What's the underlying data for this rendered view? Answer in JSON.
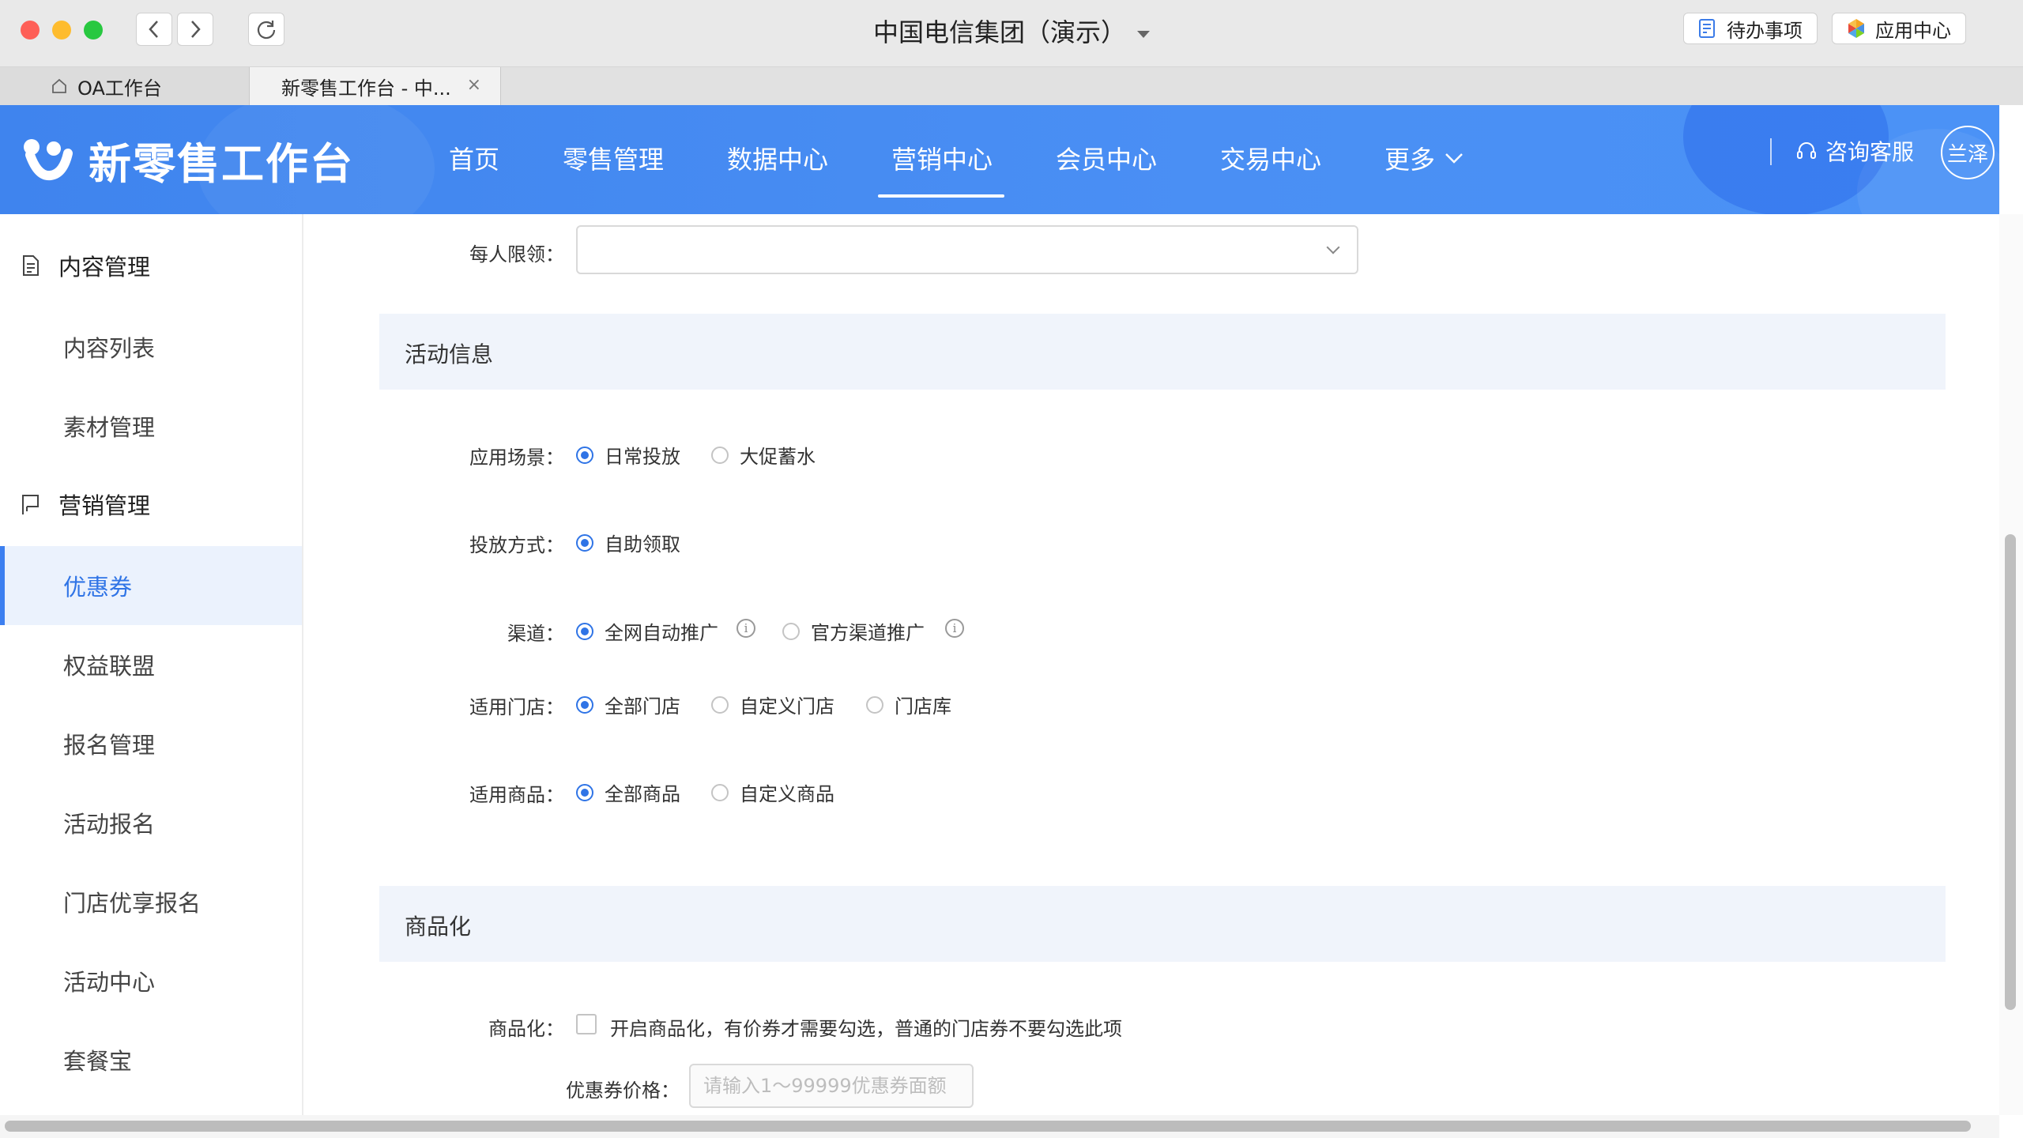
{
  "window": {
    "title": "中国电信集团（演示）",
    "todo_label": "待办事项",
    "apps_label": "应用中心"
  },
  "tabs": [
    {
      "label": "OA工作台"
    },
    {
      "label": "新零售工作台 - 中..."
    }
  ],
  "header": {
    "brand": "新零售工作台",
    "nav": [
      "首页",
      "零售管理",
      "数据中心",
      "营销中心",
      "会员中心",
      "交易中心",
      "更多"
    ],
    "active_nav": "营销中心",
    "support": "咨询客服",
    "user": "兰泽"
  },
  "sidebar": {
    "group1": "内容管理",
    "group1_items": [
      "内容列表",
      "素材管理"
    ],
    "group2": "营销管理",
    "group2_items": [
      "优惠券",
      "权益联盟",
      "报名管理",
      "活动报名",
      "门店优享报名",
      "活动中心",
      "套餐宝"
    ],
    "active_item": "优惠券"
  },
  "form": {
    "per_limit_label": "每人限领：",
    "section_activity": "活动信息",
    "scene_label": "应用场景：",
    "scene_options": [
      "日常投放",
      "大促蓄水"
    ],
    "method_label": "投放方式：",
    "method_options": [
      "自助领取"
    ],
    "channel_label": "渠道：",
    "channel_options": [
      "全网自动推广",
      "官方渠道推广"
    ],
    "store_label": "适用门店：",
    "store_options": [
      "全部门店",
      "自定义门店",
      "门店库"
    ],
    "goods_label": "适用商品：",
    "goods_options": [
      "全部商品",
      "自定义商品"
    ],
    "section_goods": "商品化",
    "commod_label": "商品化：",
    "commod_text": "开启商品化，有价券才需要勾选，普通的门店券不要勾选此项",
    "price_label": "优惠券价格：",
    "price_placeholder": "请输入1～99999优惠券面额"
  },
  "colors": {
    "header_blue": "#4a8ff4",
    "accent": "#2f74e6",
    "section_bg": "#f0f4fb"
  }
}
